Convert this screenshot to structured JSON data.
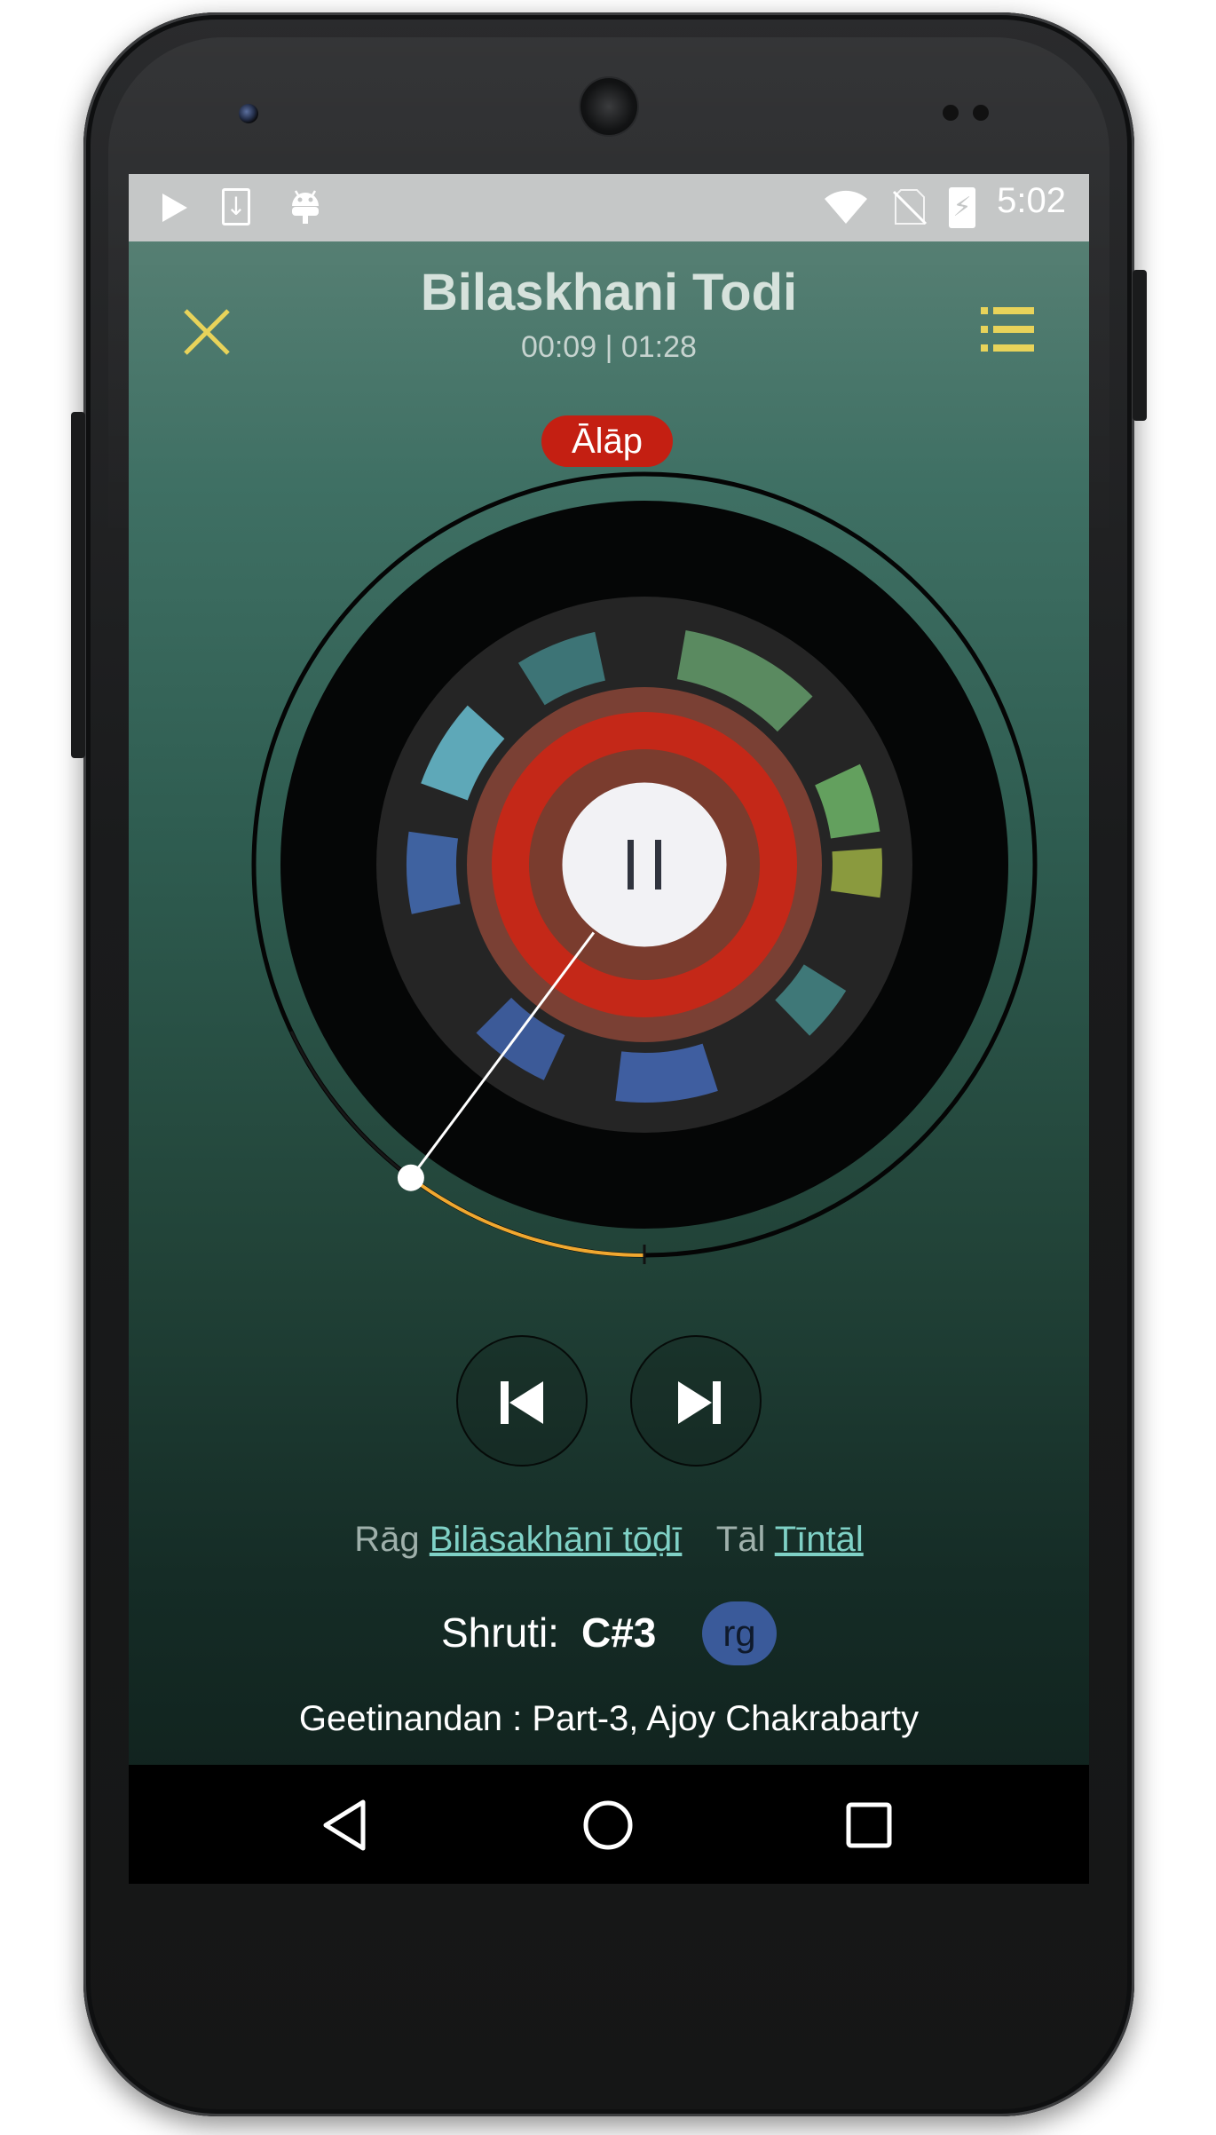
{
  "status_bar": {
    "time": "5:02",
    "icons": [
      "play-icon",
      "download-icon",
      "android-icon",
      "wifi-icon",
      "no-sim-icon",
      "battery-charging-icon"
    ]
  },
  "header": {
    "title": "Bilaskhani Todi",
    "time_display": "00:09 | 01:28",
    "close_icon": "close-icon",
    "menu_icon": "list-icon"
  },
  "section_badge": "Ālāp",
  "player": {
    "elapsed": "00:09",
    "duration": "01:28",
    "progress": 0.102,
    "play_state": "playing",
    "center_icon": "pause-icon"
  },
  "controls": {
    "previous_icon": "skip-previous-icon",
    "next_icon": "skip-next-icon"
  },
  "info": {
    "raga_prefix": "Rāg",
    "raga_name": "Bilāsakhānī tōḍī",
    "tala_prefix": "Tāl",
    "tala_name": "Tīntāl",
    "shruti_label": "Shruti:",
    "shruti_value": "C#3",
    "shruti_badge": "rg",
    "album": "Geetinandan : Part-3, Ajoy Chakrabarty"
  },
  "nav_bar": {
    "icons": [
      "back-icon",
      "home-icon",
      "recent-apps-icon"
    ]
  },
  "colors": {
    "accent_yellow": "#e8d35a",
    "badge_red": "#c41f12",
    "link_teal": "#7fd1c6",
    "shruti_blue": "#3a5a9a",
    "progress_orange": "#f0a830"
  }
}
